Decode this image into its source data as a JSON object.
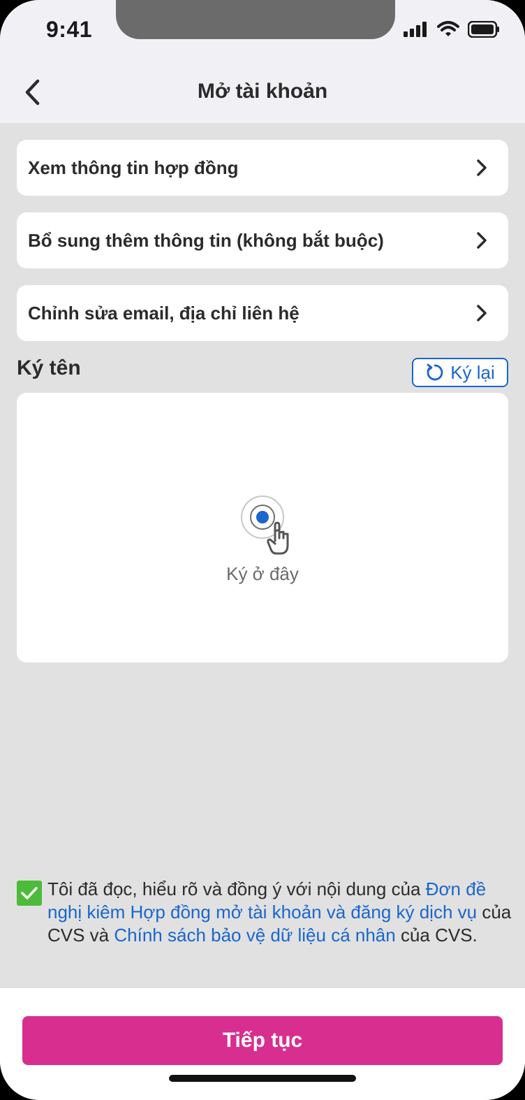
{
  "status": {
    "time": "9:41"
  },
  "header": {
    "title": "Mở tài khoản"
  },
  "menu": [
    {
      "label": "Xem thông tin hợp đồng"
    },
    {
      "label": "Bổ sung thêm thông tin (không bắt buộc)"
    },
    {
      "label": "Chỉnh sửa email, địa chỉ liên hệ"
    }
  ],
  "signature": {
    "title": "Ký tên",
    "resign_label": "Ký lại",
    "hint": "Ký ở đây"
  },
  "agreement": {
    "checked": true,
    "text_1": "Tôi đã đọc, hiểu rõ và đồng ý với nội dung của ",
    "link_1": "Đơn đề nghị kiêm Hợp đồng mở tài khoản và đăng ký dịch vụ",
    "text_2": " của CVS và ",
    "link_2": "Chính sách bảo vệ dữ liệu cá nhân",
    "text_3": " của CVS."
  },
  "footer": {
    "continue_label": "Tiếp tục"
  },
  "colors": {
    "accent": "#d82e8f",
    "link": "#1a66cc",
    "check": "#4cbb3a",
    "background": "#e1e1e1"
  }
}
